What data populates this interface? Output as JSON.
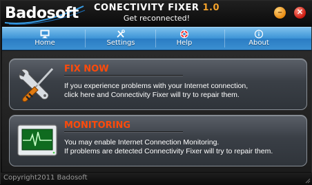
{
  "titlebar": {
    "logo": "Badosoft",
    "title": "CONECTIVITY FIXER",
    "version": "1.0",
    "subtitle": "Get reconnected!",
    "minimize_icon": "minimize-icon",
    "close_icon": "close-icon",
    "minimize_color": "#e88a10",
    "close_color": "#cc1a10"
  },
  "nav": {
    "items": [
      {
        "label": "Home",
        "icon": "monitor-icon"
      },
      {
        "label": "Settings",
        "icon": "tools-icon"
      },
      {
        "label": "Help",
        "icon": "lifebuoy-icon"
      },
      {
        "label": "About",
        "icon": "info-icon"
      }
    ],
    "bar_color": "#3b93d6"
  },
  "cards": {
    "fix": {
      "title": "FIX NOW",
      "line1": "If you experience problems with your Internet connection,",
      "line2": "click here and Connectivity Fixer will try to repair them.",
      "icon": "wrench-screwdriver-icon"
    },
    "monitoring": {
      "title": "MONITORING",
      "line1": "You may enable Internet Connection Monitoring.",
      "line2": "If problems are detected Connectivity Fixer will try to repair them.",
      "icon": "heartbeat-monitor-icon"
    },
    "title_color": "#ff4a0a"
  },
  "footer": {
    "copyright": "Copyright2011 Badosoft"
  }
}
